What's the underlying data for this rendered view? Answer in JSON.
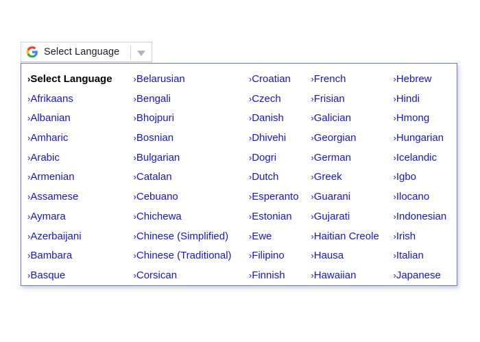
{
  "widget": {
    "button_label": "Select Language",
    "logo_name": "google-g-logo",
    "arrow_name": "dropdown-arrow-icon",
    "chevron": "›",
    "accent_color": "#1414dc",
    "panel_border_color": "#6a79c8",
    "button_border_color": "#cfcfcf",
    "logo_colors": {
      "blue": "#4285F4",
      "green": "#34A853",
      "yellow": "#FBBC05",
      "red": "#EA4335"
    }
  },
  "columns": [
    {
      "index": 0,
      "items": [
        {
          "label": "Select Language",
          "current": true
        },
        {
          "label": "Afrikaans",
          "current": false
        },
        {
          "label": "Albanian",
          "current": false
        },
        {
          "label": "Amharic",
          "current": false
        },
        {
          "label": "Arabic",
          "current": false
        },
        {
          "label": "Armenian",
          "current": false
        },
        {
          "label": "Assamese",
          "current": false
        },
        {
          "label": "Aymara",
          "current": false
        },
        {
          "label": "Azerbaijani",
          "current": false
        },
        {
          "label": "Bambara",
          "current": false
        },
        {
          "label": "Basque",
          "current": false
        }
      ]
    },
    {
      "index": 1,
      "items": [
        {
          "label": "Belarusian",
          "current": false
        },
        {
          "label": "Bengali",
          "current": false
        },
        {
          "label": "Bhojpuri",
          "current": false
        },
        {
          "label": "Bosnian",
          "current": false
        },
        {
          "label": "Bulgarian",
          "current": false
        },
        {
          "label": "Catalan",
          "current": false
        },
        {
          "label": "Cebuano",
          "current": false
        },
        {
          "label": "Chichewa",
          "current": false
        },
        {
          "label": "Chinese (Simplified)",
          "current": false
        },
        {
          "label": "Chinese (Traditional)",
          "current": false
        },
        {
          "label": "Corsican",
          "current": false
        }
      ]
    },
    {
      "index": 2,
      "items": [
        {
          "label": "Croatian",
          "current": false
        },
        {
          "label": "Czech",
          "current": false
        },
        {
          "label": "Danish",
          "current": false
        },
        {
          "label": "Dhivehi",
          "current": false
        },
        {
          "label": "Dogri",
          "current": false
        },
        {
          "label": "Dutch",
          "current": false
        },
        {
          "label": "Esperanto",
          "current": false
        },
        {
          "label": "Estonian",
          "current": false
        },
        {
          "label": "Ewe",
          "current": false
        },
        {
          "label": "Filipino",
          "current": false
        },
        {
          "label": "Finnish",
          "current": false
        }
      ]
    },
    {
      "index": 3,
      "items": [
        {
          "label": "French",
          "current": false
        },
        {
          "label": "Frisian",
          "current": false
        },
        {
          "label": "Galician",
          "current": false
        },
        {
          "label": "Georgian",
          "current": false
        },
        {
          "label": "German",
          "current": false
        },
        {
          "label": "Greek",
          "current": false
        },
        {
          "label": "Guarani",
          "current": false
        },
        {
          "label": "Gujarati",
          "current": false
        },
        {
          "label": "Haitian Creole",
          "current": false
        },
        {
          "label": "Hausa",
          "current": false
        },
        {
          "label": "Hawaiian",
          "current": false
        }
      ]
    },
    {
      "index": 4,
      "items": [
        {
          "label": "Hebrew",
          "current": false
        },
        {
          "label": "Hindi",
          "current": false
        },
        {
          "label": "Hmong",
          "current": false
        },
        {
          "label": "Hungarian",
          "current": false
        },
        {
          "label": "Icelandic",
          "current": false
        },
        {
          "label": "Igbo",
          "current": false
        },
        {
          "label": "Ilocano",
          "current": false
        },
        {
          "label": "Indonesian",
          "current": false
        },
        {
          "label": "Irish",
          "current": false
        },
        {
          "label": "Italian",
          "current": false
        },
        {
          "label": "Japanese",
          "current": false
        }
      ]
    }
  ]
}
